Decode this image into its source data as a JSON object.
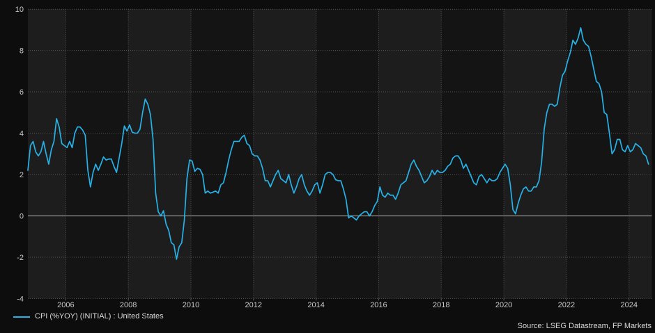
{
  "chart_data": {
    "type": "line",
    "title": "",
    "xlabel": "",
    "ylabel": "",
    "ylim": [
      -4,
      10
    ],
    "xlim": [
      2004.79,
      2024.73
    ],
    "y_ticks": [
      10,
      8,
      6,
      4,
      2,
      0,
      -2,
      -4
    ],
    "x_ticks": [
      2006,
      2008,
      2010,
      2012,
      2014,
      2016,
      2018,
      2020,
      2022,
      2024
    ],
    "grid": "dotted gridlines at every y tick and every even-year x tick",
    "zero_line": true,
    "background_bands": "alternating 2-year vertical bands starting light at 2004",
    "legend_position": "bottom-left",
    "series": [
      {
        "name": "CPI (%YOY) (INITIAL) : United States",
        "frequency": "monthly",
        "start_year": 2004,
        "start_month": 10,
        "end_year": 2024,
        "end_month": 8,
        "values": [
          2.2,
          3.4,
          3.6,
          3.1,
          2.9,
          3.1,
          3.6,
          3.0,
          2.5,
          3.2,
          3.6,
          4.7,
          4.3,
          3.5,
          3.4,
          3.3,
          3.6,
          3.3,
          4.0,
          4.3,
          4.3,
          4.15,
          3.9,
          2.2,
          1.4,
          2.1,
          2.5,
          2.2,
          2.5,
          2.85,
          2.7,
          2.75,
          2.75,
          2.4,
          2.1,
          2.8,
          3.5,
          4.35,
          4.1,
          4.4,
          4.05,
          4.0,
          4.0,
          4.2,
          5.0,
          5.65,
          5.4,
          4.9,
          3.7,
          1.1,
          0.2,
          0.0,
          0.25,
          -0.4,
          -0.7,
          -1.3,
          -1.4,
          -2.1,
          -1.5,
          -1.3,
          -0.2,
          1.8,
          2.7,
          2.65,
          2.15,
          2.3,
          2.25,
          2.0,
          1.1,
          1.2,
          1.1,
          1.15,
          1.2,
          1.1,
          1.5,
          1.6,
          2.1,
          2.7,
          3.2,
          3.6,
          3.6,
          3.6,
          3.8,
          3.9,
          3.5,
          3.4,
          3.0,
          2.9,
          2.9,
          2.7,
          2.3,
          1.7,
          1.7,
          1.4,
          1.7,
          2.0,
          2.2,
          1.8,
          1.7,
          1.6,
          2.0,
          1.5,
          1.1,
          1.4,
          1.8,
          2.0,
          1.5,
          1.2,
          1.0,
          1.2,
          1.5,
          1.6,
          1.1,
          1.5,
          2.0,
          2.1,
          2.1,
          2.0,
          1.75,
          1.7,
          1.7,
          1.3,
          0.8,
          -0.1,
          0.0,
          -0.1,
          -0.2,
          0.0,
          0.1,
          0.2,
          0.2,
          0.0,
          0.2,
          0.5,
          0.7,
          1.4,
          1.0,
          0.9,
          1.1,
          1.0,
          1.0,
          0.8,
          1.1,
          1.5,
          1.6,
          1.7,
          2.1,
          2.5,
          2.7,
          2.4,
          2.2,
          1.9,
          1.6,
          1.7,
          1.9,
          2.2,
          2.0,
          2.2,
          2.1,
          2.1,
          2.2,
          2.4,
          2.5,
          2.8,
          2.9,
          2.9,
          2.7,
          2.3,
          2.5,
          2.2,
          1.9,
          1.6,
          1.5,
          1.9,
          2.0,
          1.8,
          1.6,
          1.8,
          1.7,
          1.7,
          1.8,
          2.1,
          2.3,
          2.5,
          2.3,
          1.5,
          0.3,
          0.1,
          0.6,
          1.0,
          1.3,
          1.4,
          1.2,
          1.2,
          1.4,
          1.4,
          1.7,
          2.6,
          4.2,
          5.0,
          5.4,
          5.4,
          5.3,
          5.4,
          6.2,
          6.8,
          7.0,
          7.5,
          7.9,
          8.5,
          8.3,
          8.6,
          9.1,
          8.5,
          8.3,
          8.2,
          7.7,
          7.1,
          6.5,
          6.4,
          6.0,
          5.0,
          4.9,
          4.0,
          3.0,
          3.2,
          3.7,
          3.7,
          3.2,
          3.1,
          3.4,
          3.1,
          3.2,
          3.5,
          3.4,
          3.3,
          3.0,
          2.9,
          2.5
        ]
      }
    ]
  },
  "legend": {
    "label": "CPI (%YOY) (INITIAL) : United States"
  },
  "source": {
    "text": "Source: LSEG Datastream, FP Markets"
  },
  "colors": {
    "line": "#27b2e7",
    "page_bg": "#0d0d0d",
    "band_light": "#1d1d1d",
    "band_dark": "#141414",
    "grid_dotted": "#585858",
    "zero_line": "#8f8f8f",
    "axis_text": "#c9c9c9",
    "legend_text": "#d9d9d9",
    "source_text": "#d9d9d9"
  }
}
